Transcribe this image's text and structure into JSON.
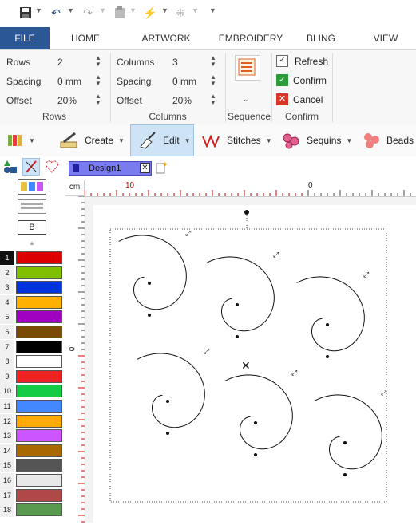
{
  "quick_access": {
    "icons": [
      "save-icon",
      "undo-icon",
      "redo-icon",
      "clipboard-icon",
      "lightning-icon",
      "dots-pattern-icon"
    ]
  },
  "tabs": [
    "FILE",
    "HOME",
    "ARTWORK",
    "EMBROIDERY",
    "BLING",
    "VIEW"
  ],
  "active_tab": "FILE",
  "ribbon": {
    "rows_label": "Rows",
    "rows_value": "2",
    "row_spacing_label": "Spacing",
    "row_spacing_value": "0 mm",
    "row_offset_label": "Offset",
    "row_offset_value": "20%",
    "rows_group": "Rows",
    "columns_label": "Columns",
    "columns_value": "3",
    "col_spacing_label": "Spacing",
    "col_spacing_value": "0 mm",
    "col_offset_label": "Offset",
    "col_offset_value": "20%",
    "columns_group": "Columns",
    "sequence_group": "Sequence",
    "refresh_label": "Refresh",
    "confirm_label": "Confirm",
    "cancel_label": "Cancel",
    "confirm_group": "Confirm"
  },
  "toolbar2": {
    "create": "Create",
    "edit": "Edit",
    "stitches": "Stitches",
    "sequins": "Sequins",
    "beads": "Beads"
  },
  "left_panel": {
    "b_label": "B",
    "colors": [
      {
        "num": "1",
        "hex": "#dd0000",
        "selected": true
      },
      {
        "num": "2",
        "hex": "#80c000"
      },
      {
        "num": "3",
        "hex": "#0033dd"
      },
      {
        "num": "4",
        "hex": "#ffb000"
      },
      {
        "num": "5",
        "hex": "#a000c0"
      },
      {
        "num": "6",
        "hex": "#7a4a00"
      },
      {
        "num": "7",
        "hex": "#000000"
      },
      {
        "num": "8",
        "hex": "#ffffff"
      },
      {
        "num": "9",
        "hex": "#ee2222"
      },
      {
        "num": "10",
        "hex": "#11cc44"
      },
      {
        "num": "11",
        "hex": "#4488ff"
      },
      {
        "num": "12",
        "hex": "#ffaa00"
      },
      {
        "num": "13",
        "hex": "#cc55ff"
      },
      {
        "num": "14",
        "hex": "#a86a00"
      },
      {
        "num": "15",
        "hex": "#555555"
      },
      {
        "num": "16",
        "hex": "#e8e8e8"
      },
      {
        "num": "17",
        "hex": "#b04848"
      },
      {
        "num": "18",
        "hex": "#5a9a50"
      }
    ]
  },
  "document": {
    "tab_title": "Design1"
  },
  "ruler": {
    "unit": "cm",
    "h_labels": [
      "10",
      "0"
    ],
    "v_labels": [
      "0"
    ]
  }
}
